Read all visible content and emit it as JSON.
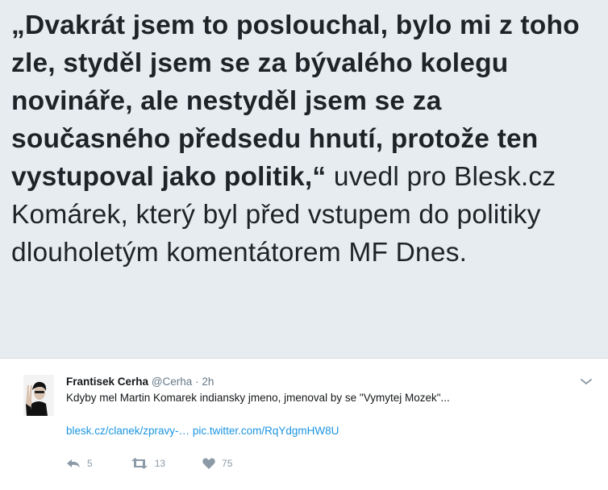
{
  "quote": {
    "bold_text": "„Dvakrát jsem to poslouchal, bylo mi z toho zle, styděl jsem se za bývalého kolegu novináře, ale nestyděl jsem se za současného předsedu hnutí, protože ten vystupoval jako politik,“",
    "normal_text": "uvedl pro Blesk.cz Komárek, který byl před vstupem do politiky dlouholetým komentátorem MF Dnes."
  },
  "tweet": {
    "author_name": "Frantisek Cerha",
    "handle": "@Cerha",
    "separator": "·",
    "time": "2h",
    "text": "Kdyby mel Martin Komarek indiansky jmeno, jmenoval by se \"Vymytej Mozek\"...",
    "link_1": "blesk.cz/clanek/zpravy-…",
    "link_2": "pic.twitter.com/RqYdgmHW8U",
    "reply_count": "5",
    "retweet_count": "13",
    "like_count": "75"
  },
  "icons": {
    "reply": "reply-icon",
    "retweet": "retweet-icon",
    "like": "heart-icon",
    "menu": "chevron-down-icon"
  },
  "colors": {
    "quote_background": "#e6ecf0",
    "link": "#1b95e0",
    "muted": "#8c99a6"
  }
}
